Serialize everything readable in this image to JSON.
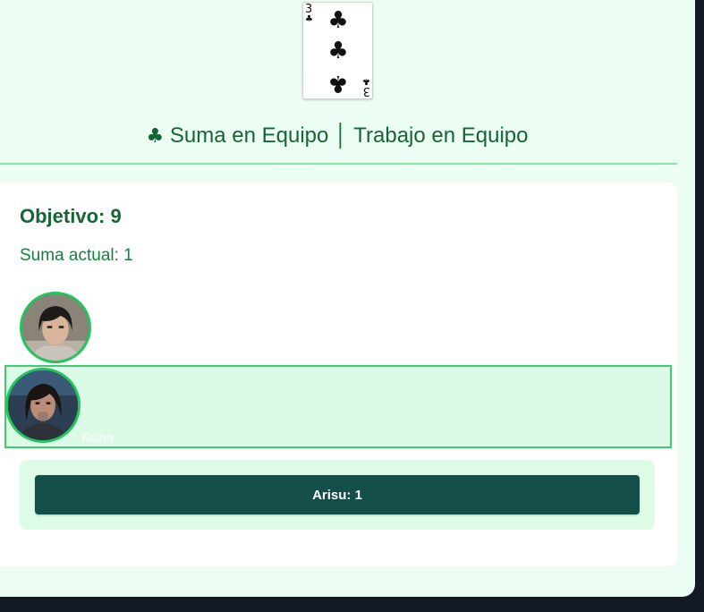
{
  "card": {
    "rank": "3",
    "suit_symbol": "♣",
    "suit_name": "clubs"
  },
  "game": {
    "title_symbol": "♣",
    "title_text": "Suma en Equipo │ Trabajo en Equipo"
  },
  "objective": {
    "label": "Objetivo: 9"
  },
  "current_sum": {
    "label": "Suma actual: 1"
  },
  "players": [
    {
      "avatar": "player-avatar-1",
      "name": ""
    },
    {
      "avatar": "player-avatar-2",
      "name": "Kuina"
    }
  ],
  "action_button": {
    "label": "Arisu: 1"
  },
  "colors": {
    "accent_green": "#22c55e",
    "dark_teal": "#134e4a",
    "panel_bg": "#ecfdf3"
  }
}
